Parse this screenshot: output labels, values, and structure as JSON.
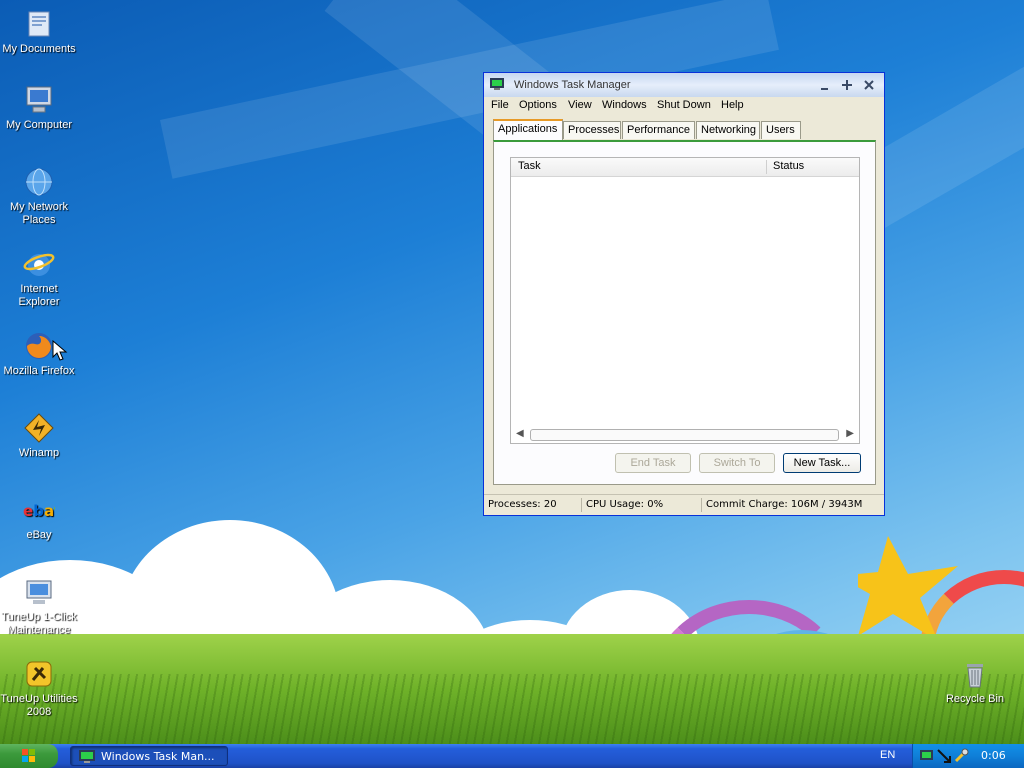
{
  "desktop": {
    "icons": [
      {
        "label": "My Documents",
        "icon": "folder-documents-icon"
      },
      {
        "label": "My Computer",
        "icon": "computer-icon"
      },
      {
        "label": "My Network Places",
        "icon": "network-globe-icon"
      },
      {
        "label": "Internet Explorer",
        "icon": "internet-explorer-icon"
      },
      {
        "label": "Mozilla Firefox",
        "icon": "firefox-icon"
      },
      {
        "label": "Winamp",
        "icon": "winamp-icon"
      },
      {
        "label": "eBay",
        "icon": "ebay-icon"
      },
      {
        "label": "TuneUp 1-Click Maintenance",
        "icon": "tuneup-maintenance-icon"
      },
      {
        "label": "TuneUp Utilities 2008",
        "icon": "tuneup-utilities-icon"
      },
      {
        "label": "Recycle Bin",
        "icon": "recycle-bin-icon"
      }
    ]
  },
  "window": {
    "title": "Windows Task Manager",
    "menu": [
      "File",
      "Options",
      "View",
      "Windows",
      "Shut Down",
      "Help"
    ],
    "tabs": [
      "Applications",
      "Processes",
      "Performance",
      "Networking",
      "Users"
    ],
    "active_tab": "Applications",
    "columns": [
      "Task",
      "Status"
    ],
    "rows": [],
    "buttons": {
      "end_task": "End Task",
      "switch_to": "Switch To",
      "new_task": "New Task..."
    },
    "status": {
      "processes": "Processes: 20",
      "cpu": "CPU Usage: 0%",
      "commit": "Commit Charge: 106M / 3943M"
    }
  },
  "taskbar": {
    "task_label": "Windows Task Man...",
    "language": "EN",
    "clock": "0:06"
  },
  "colors": {
    "window_border": "#0831d9",
    "taskbar": "#245edb",
    "start": "#3c9a3c",
    "tab_accent": "#e79a27",
    "panel_accent": "#3b9b3b"
  }
}
